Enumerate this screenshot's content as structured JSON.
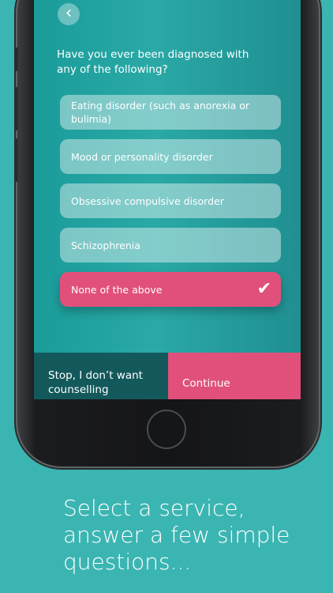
{
  "screen": {
    "back_icon": "chevron-left-icon",
    "question": "Have you ever been diagnosed with any of the following?",
    "options": [
      {
        "label": "Eating disorder (such as anorexia or bulimia)",
        "selected": false
      },
      {
        "label": "Mood or personality disorder",
        "selected": false
      },
      {
        "label": "Obsessive compulsive disorder",
        "selected": false
      },
      {
        "label": "Schizophrenia",
        "selected": false
      },
      {
        "label": "None of the above",
        "selected": true
      }
    ],
    "check_icon": "checkmark-icon",
    "stop_label": "Stop, I don’t want counselling",
    "continue_label": "Continue"
  },
  "caption": "Select a service, answer a few simple questions...",
  "colors": {
    "background": "#3bb5b2",
    "accent_pink": "#e0507b",
    "dark_teal": "#13595c"
  }
}
